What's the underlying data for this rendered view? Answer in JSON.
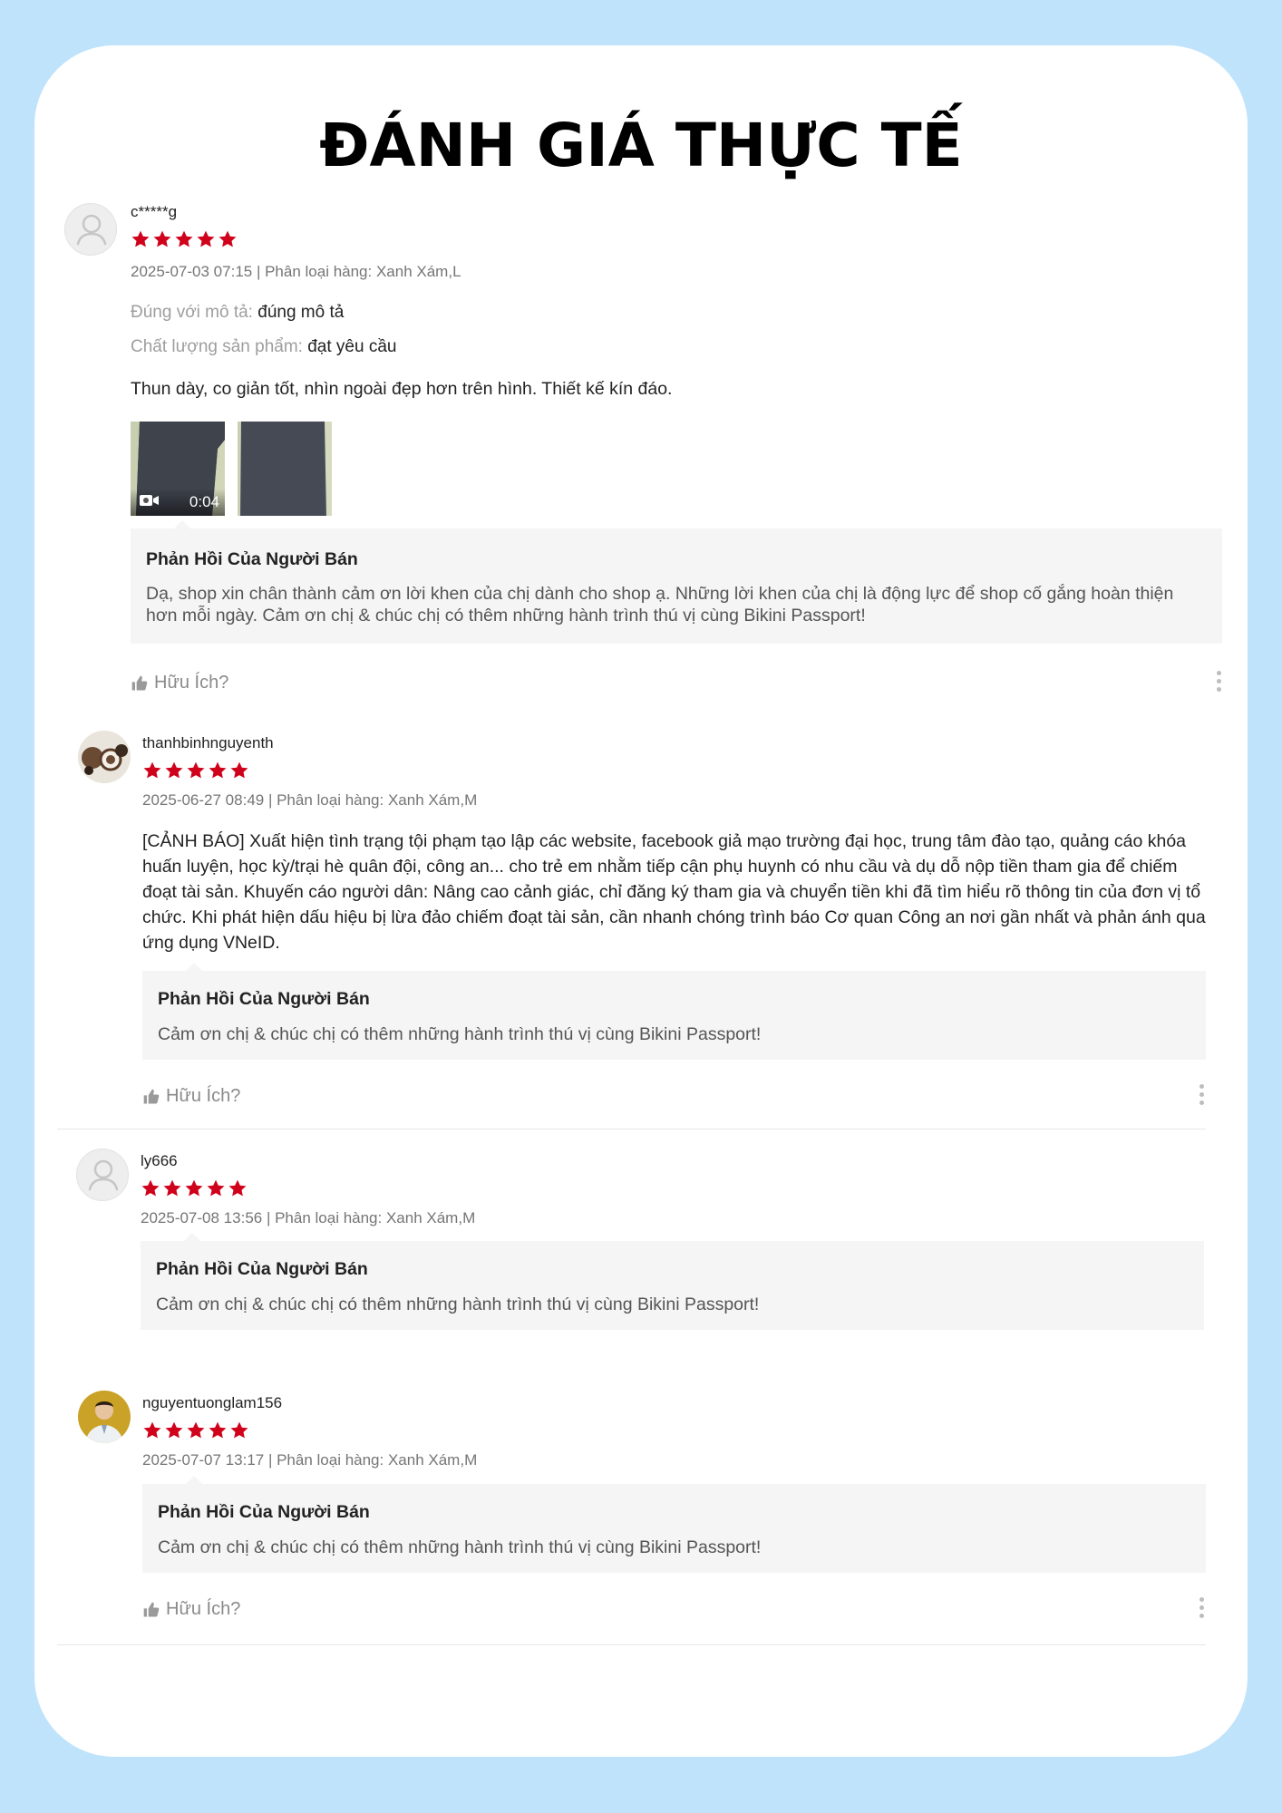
{
  "page": {
    "title": "ĐÁNH GIÁ THỰC TẾ",
    "colors": {
      "background": "#bfe3fb",
      "star": "#d0011b",
      "reply_bg": "#f5f5f5",
      "meta": "#757575"
    }
  },
  "helpful_label": "Hữu Ích?",
  "reply_title": "Phản Hồi Của Người Bán",
  "reviews": [
    {
      "username": "c*****g",
      "avatar": "default-user-icon",
      "rating": 5,
      "meta": "2025-07-03 07:15 | Phân loại hàng: Xanh Xám,L",
      "fields": [
        {
          "key": "Đúng với mô tả:",
          "value": "đúng mô tả"
        },
        {
          "key": "Chất lượng sản phẩm:",
          "value": "đạt yêu cầu"
        }
      ],
      "comment": "Thun dày, co giản tốt, nhìn ngoài đẹp hơn trên hình. Thiết kế kín đáo.",
      "media": [
        {
          "type": "video",
          "duration": "0:04"
        },
        {
          "type": "image"
        }
      ],
      "reply": "Dạ, shop xin chân thành cảm ơn lời khen của chị dành cho shop ạ. Những lời khen của chị là động lực để shop cố gắng hoàn thiện hơn mỗi ngày. Cảm ơn chị & chúc chị có thêm những hành trình thú vị cùng Bikini Passport!"
    },
    {
      "username": "thanhbinhnguyenth",
      "avatar": "photo-avatar",
      "rating": 5,
      "meta": "2025-06-27 08:49 | Phân loại hàng: Xanh Xám,M",
      "comment": "[CẢNH BÁO] Xuất hiện tình trạng tội phạm tạo lập các website, facebook giả mạo trường đại học, trung tâm đào tạo, quảng cáo khóa huấn luyện, học kỳ/trại hè quân đội, công an... cho trẻ em nhằm tiếp cận phụ huynh có nhu cầu và dụ dỗ nộp tiền tham gia để chiếm đoạt tài sản. Khuyến cáo người dân: Nâng cao cảnh giác, chỉ đăng ký tham gia và chuyển tiền khi đã tìm hiểu rõ thông tin của đơn vị tổ chức. Khi phát hiện dấu hiệu bị lừa đảo chiếm đoạt tài sản, cần nhanh chóng trình báo Cơ quan Công an nơi gần nhất và phản ánh qua ứng dụng VNeID.",
      "reply": "Cảm ơn chị & chúc chị có thêm những hành trình thú vị cùng Bikini Passport!"
    },
    {
      "username": "ly666",
      "avatar": "default-user-icon",
      "rating": 5,
      "meta": "2025-07-08 13:56 | Phân loại hàng: Xanh Xám,M",
      "reply": "Cảm ơn chị & chúc chị có thêm những hành trình thú vị cùng Bikini Passport!"
    },
    {
      "username": "nguyentuonglam156",
      "avatar": "photo-avatar",
      "rating": 5,
      "meta": "2025-07-07 13:17 | Phân loại hàng: Xanh Xám,M",
      "reply": "Cảm ơn chị & chúc chị có thêm những hành trình thú vị cùng Bikini Passport!"
    }
  ]
}
